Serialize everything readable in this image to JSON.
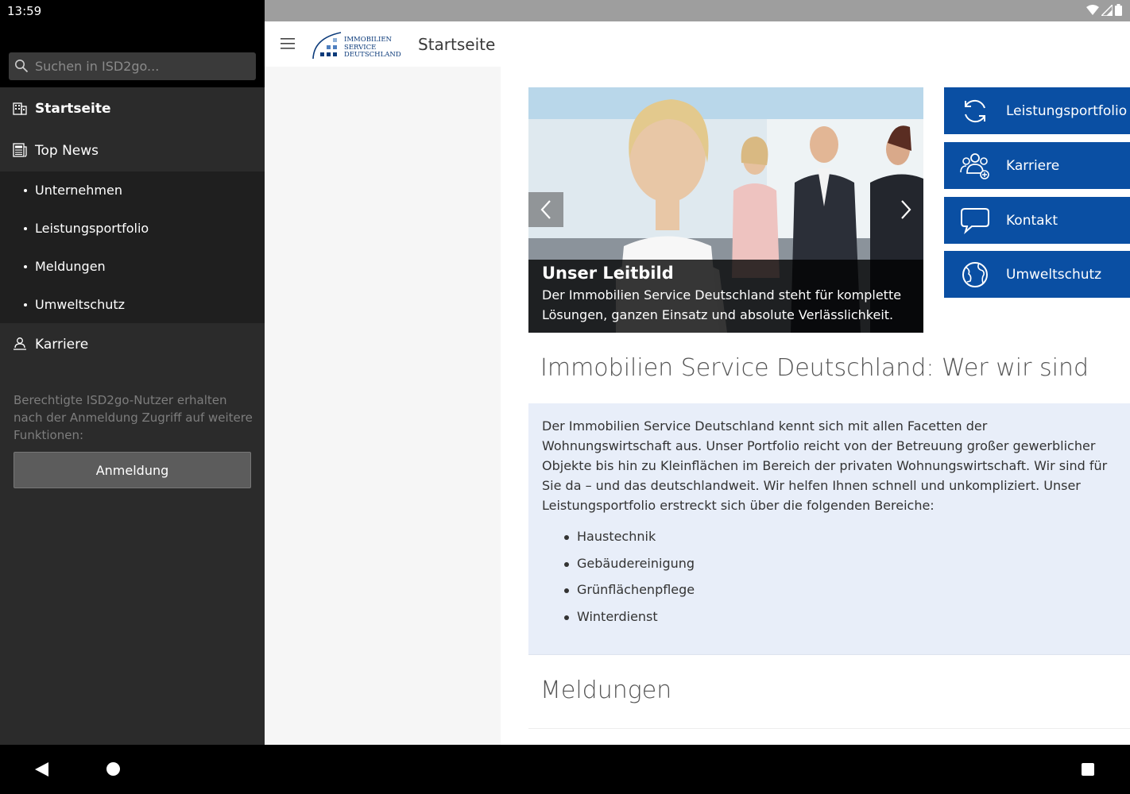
{
  "status_bar": {
    "time": "13:59"
  },
  "drawer": {
    "search_placeholder": "Suchen in ISD2go...",
    "items": [
      {
        "label": "Startseite",
        "icon": "building-icon",
        "active": true
      },
      {
        "label": "Top News",
        "icon": "newspaper-icon",
        "active": false
      }
    ],
    "sub_items": [
      {
        "label": "Unternehmen"
      },
      {
        "label": "Leistungsportfolio"
      },
      {
        "label": "Meldungen"
      },
      {
        "label": "Umweltschutz"
      }
    ],
    "karriere_label": "Karriere",
    "note": "Berechtigte ISD2go-Nutzer erhalten nach der Anmeldung Zugriff auf weitere Funktionen:",
    "login_label": "Anmeldung"
  },
  "appbar": {
    "logo_lines": [
      "IMMOBILIEN",
      "SERVICE",
      "DEUTSCHLAND"
    ],
    "title": "Startseite"
  },
  "carousel": {
    "title": "Unser Leitbild",
    "text": "Der Immobilien Service Deutschland steht für komplette Lösungen, ganzen Einsatz und absolute Verlässlichkeit."
  },
  "tiles": [
    {
      "label": "Leistungsportfolio",
      "icon": "refresh-icon"
    },
    {
      "label": "Karriere",
      "icon": "team-icon"
    },
    {
      "label": "Kontakt",
      "icon": "chat-bubble-icon"
    },
    {
      "label": "Umweltschutz",
      "icon": "globe-icon"
    }
  ],
  "main": {
    "heading": "Immobilien Service Deutschland: Wer wir sind",
    "intro": "Der Immobilien Service Deutschland kennt sich mit allen Facetten der Wohnungswirtschaft aus. Unser Portfolio reicht von der Betreuung großer gewerblicher Objekte bis hin zu Kleinflächen im Bereich der privaten Wohnungswirtschaft. Wir sind für Sie da – und das deutschlandweit. Wir helfen Ihnen schnell und unkompliziert. Unser Leistungsportfolio erstreckt sich über die folgenden Bereiche:",
    "services": [
      "Haustechnik",
      "Gebäudereinigung",
      "Grünflächenpflege",
      "Winterdienst"
    ],
    "heading2": "Meldungen"
  },
  "colors": {
    "accent": "#0a4fa3",
    "drawer_bg": "#2b2b2b",
    "info_bg": "#e8eef9"
  }
}
